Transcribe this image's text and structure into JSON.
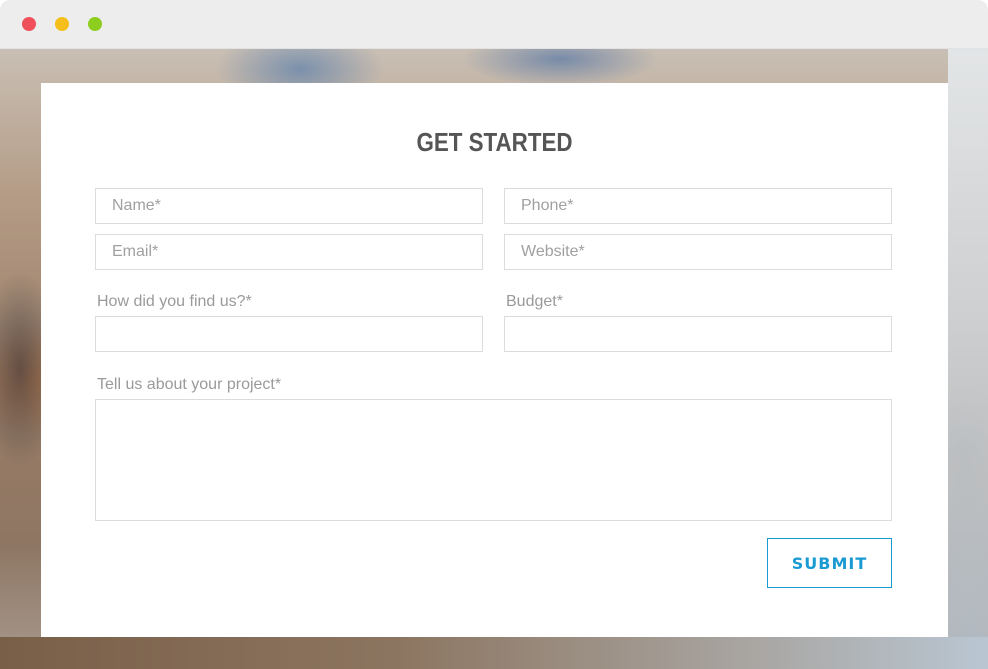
{
  "window": {
    "controls": [
      {
        "name": "close",
        "color": "#f0505a"
      },
      {
        "name": "minimize",
        "color": "#f4bf1b"
      },
      {
        "name": "zoom",
        "color": "#8ccd1e"
      }
    ]
  },
  "form": {
    "title": "GET STARTED",
    "name": {
      "placeholder": "Name*",
      "value": ""
    },
    "phone": {
      "placeholder": "Phone*",
      "value": ""
    },
    "email": {
      "placeholder": "Email*",
      "value": ""
    },
    "website": {
      "placeholder": "Website*",
      "value": ""
    },
    "find_us": {
      "label": "How did you find us?*",
      "value": ""
    },
    "budget": {
      "label": "Budget*",
      "value": ""
    },
    "project": {
      "label": "Tell us about your project*",
      "value": ""
    },
    "submit_label": "SUBMIT"
  },
  "colors": {
    "accent": "#1a9ad2",
    "title_text": "#555555",
    "label_text": "#9a9a9a",
    "field_border": "#dcdcdc"
  }
}
